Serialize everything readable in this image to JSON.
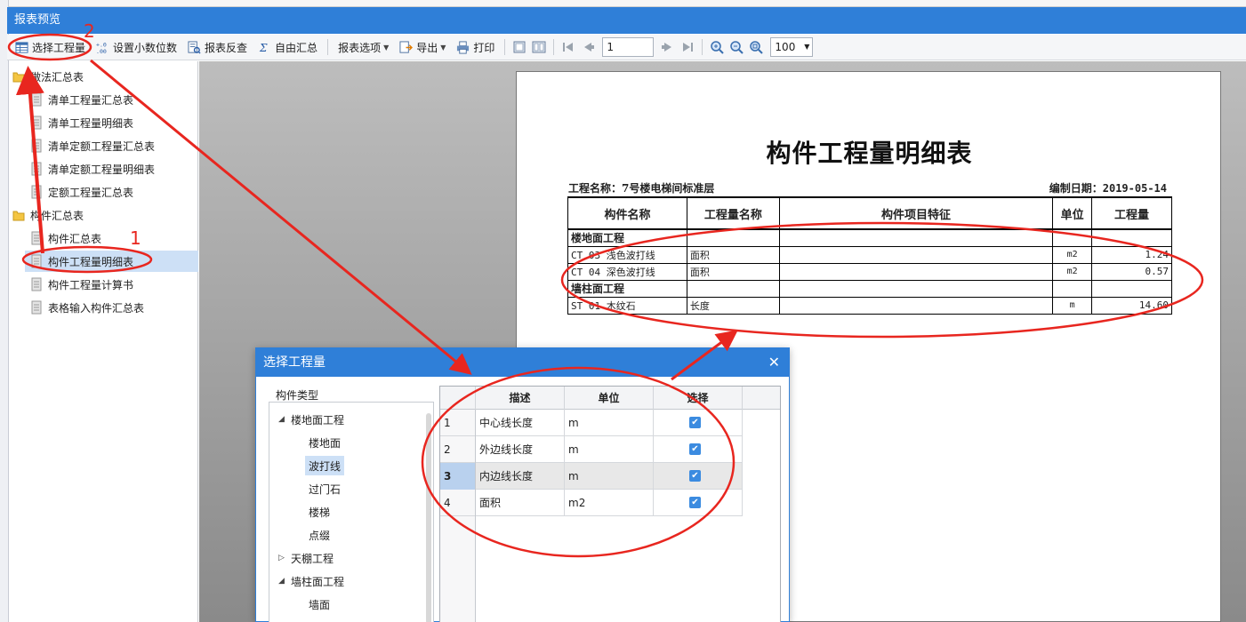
{
  "window": {
    "title": "报表预览"
  },
  "toolbar": {
    "select_quantity": "选择工程量",
    "set_decimals": "设置小数位数",
    "report_check": "报表反查",
    "custom_summary": "自由汇总",
    "report_options": "报表选项",
    "export": "导出",
    "print": "打印",
    "page_number": "1",
    "zoom": "100"
  },
  "tree": {
    "groups": [
      {
        "label": "做法汇总表",
        "items": [
          "清单工程量汇总表",
          "清单工程量明细表",
          "清单定额工程量汇总表",
          "清单定额工程量明细表",
          "定额工程量汇总表"
        ]
      },
      {
        "label": "构件汇总表",
        "items": [
          "构件汇总表",
          "构件工程量明细表",
          "构件工程量计算书",
          "表格输入构件汇总表"
        ]
      }
    ],
    "selected": "构件工程量明细表"
  },
  "report": {
    "title": "构件工程量明细表",
    "project": "工程名称：7号楼电梯间标准层",
    "date": "编制日期：2019-05-14",
    "headers": [
      "构件名称",
      "工程量名称",
      "构件项目特征",
      "单位",
      "工程量"
    ],
    "rows": [
      {
        "group": "楼地面工程"
      },
      {
        "name": "CT 03 浅色波打线",
        "qty_name": "面积",
        "feature": "",
        "unit": "m2",
        "value": "1.24"
      },
      {
        "name": "CT 04 深色波打线",
        "qty_name": "面积",
        "feature": "",
        "unit": "m2",
        "value": "0.57"
      },
      {
        "group": "墙柱面工程"
      },
      {
        "name": "ST 01 木纹石",
        "qty_name": "长度",
        "feature": "",
        "unit": "m",
        "value": "14.60"
      }
    ]
  },
  "dialog": {
    "title": "选择工程量",
    "close": "✕",
    "type_label": "构件类型",
    "types": [
      {
        "label": "楼地面工程",
        "level": 0,
        "arrow": "◢"
      },
      {
        "label": "楼地面",
        "level": 1
      },
      {
        "label": "波打线",
        "level": 1,
        "selected": true
      },
      {
        "label": "过门石",
        "level": 1
      },
      {
        "label": "楼梯",
        "level": 1
      },
      {
        "label": "点缀",
        "level": 1
      },
      {
        "label": "天棚工程",
        "level": 0,
        "arrow": "▷"
      },
      {
        "label": "墙柱面工程",
        "level": 0,
        "arrow": "◢"
      },
      {
        "label": "墙面",
        "level": 1
      }
    ],
    "grid_headers": [
      "描述",
      "单位",
      "选择"
    ],
    "grid_rows": [
      {
        "num": "1",
        "desc": "中心线长度",
        "unit": "m",
        "checked": true
      },
      {
        "num": "2",
        "desc": "外边线长度",
        "unit": "m",
        "checked": true
      },
      {
        "num": "3",
        "desc": "内边线长度",
        "unit": "m",
        "checked": true,
        "current": true
      },
      {
        "num": "4",
        "desc": "面积",
        "unit": "m2",
        "checked": true
      }
    ]
  },
  "annotations": {
    "mark1": "1",
    "mark2": "2",
    "color": "#e8261f"
  },
  "colors": {
    "titlebar": "#2f7fd8",
    "selection": "#cde0f6",
    "checkbox": "#3b8be0"
  }
}
